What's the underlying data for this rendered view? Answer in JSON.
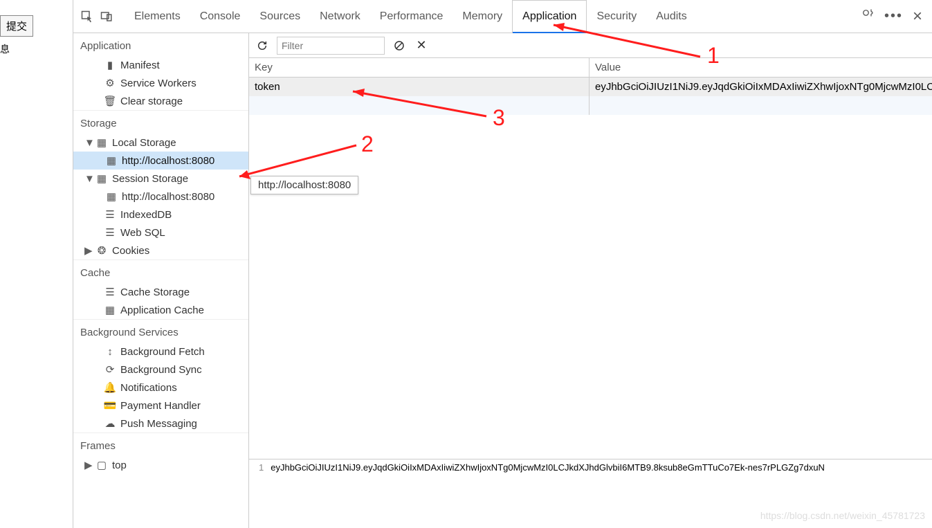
{
  "external": {
    "submit_btn": "提交",
    "msg": "息"
  },
  "tabs": {
    "elements": "Elements",
    "console": "Console",
    "sources": "Sources",
    "network": "Network",
    "performance": "Performance",
    "memory": "Memory",
    "application": "Application",
    "security": "Security",
    "audits": "Audits"
  },
  "active_tab": "application",
  "sidebar": {
    "application": {
      "title": "Application",
      "items": [
        {
          "label": "Manifest"
        },
        {
          "label": "Service Workers"
        },
        {
          "label": "Clear storage"
        }
      ]
    },
    "storage": {
      "title": "Storage",
      "local_storage": {
        "label": "Local Storage",
        "children": [
          {
            "label": "http://localhost:8080",
            "selected": true
          }
        ]
      },
      "session_storage": {
        "label": "Session Storage",
        "children": [
          {
            "label": "http://localhost:8080"
          }
        ]
      },
      "indexeddb": {
        "label": "IndexedDB"
      },
      "websql": {
        "label": "Web SQL"
      },
      "cookies": {
        "label": "Cookies"
      }
    },
    "cache": {
      "title": "Cache",
      "items": [
        {
          "label": "Cache Storage"
        },
        {
          "label": "Application Cache"
        }
      ]
    },
    "background": {
      "title": "Background Services",
      "items": [
        {
          "label": "Background Fetch"
        },
        {
          "label": "Background Sync"
        },
        {
          "label": "Notifications"
        },
        {
          "label": "Payment Handler"
        },
        {
          "label": "Push Messaging"
        }
      ]
    },
    "frames": {
      "title": "Frames",
      "items": [
        {
          "label": "top"
        }
      ]
    }
  },
  "toolbar": {
    "filter_placeholder": "Filter"
  },
  "table": {
    "key_header": "Key",
    "value_header": "Value",
    "rows": [
      {
        "key": "token",
        "value": "eyJhbGciOiJIUzI1NiJ9.eyJqdGkiOiIxMDAxIiwiZXhwIjoxNTg0MjcwMzI0LC..."
      }
    ]
  },
  "tooltip": "http://localhost:8080",
  "value_preview": {
    "lineno": "1",
    "text": "eyJhbGciOiJIUzI1NiJ9.eyJqdGkiOiIxMDAxIiwiZXhwIjoxNTg0MjcwMzI0LCJkdXJhdGlvbiI6MTB9.8ksub8eGmTTuCo7Ek-nes7rPLGZg7dxuN"
  },
  "watermark": "https://blog.csdn.net/weixin_45781723",
  "annotations": {
    "n1": "1",
    "n2": "2",
    "n3": "3"
  }
}
